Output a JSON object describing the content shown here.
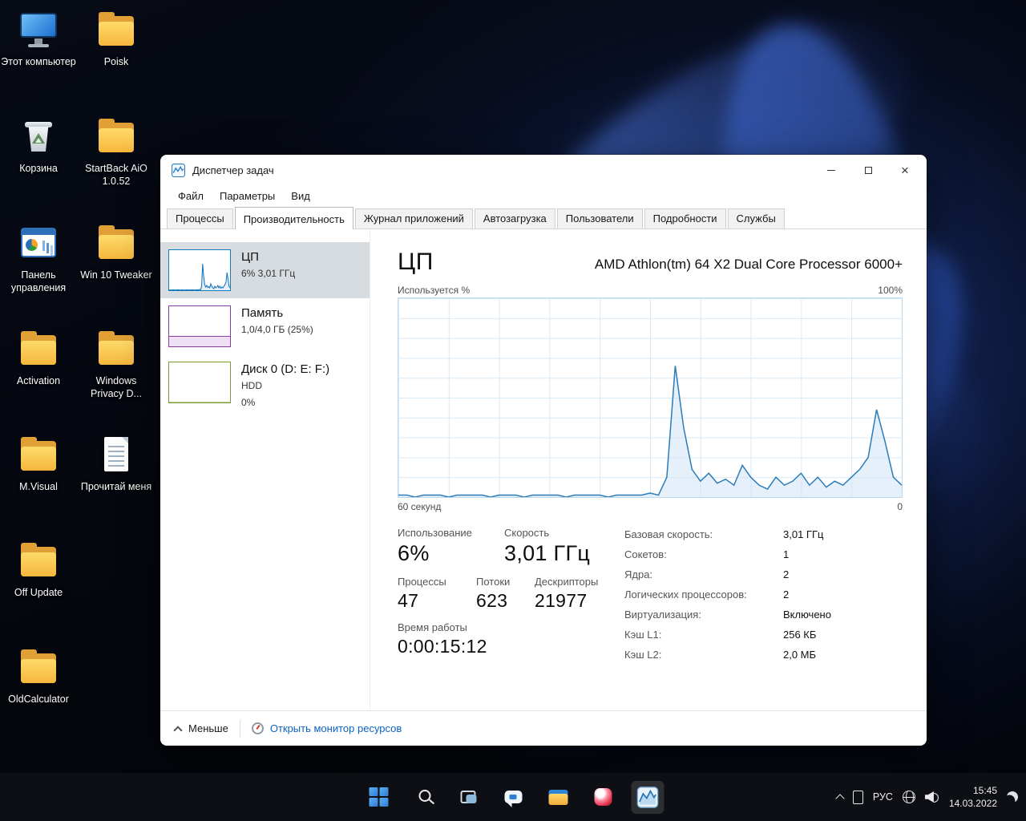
{
  "theme": {
    "accent_blue": "#0078d4",
    "cpu_color": "#117dbb",
    "memory_color": "#8b3ba6",
    "disk_color": "#7d9b38",
    "link_color": "#0a62c4",
    "folder_yellow": "#f6b73c",
    "taskbar_bg": "#0d1015",
    "selected_sidebar_bg": "#d6dce0"
  },
  "desktop": {
    "icons": [
      {
        "label": "Этот компьютер",
        "type": "computer"
      },
      {
        "label": "Poisk",
        "type": "folder"
      },
      {
        "label": "Корзина",
        "type": "recycle-bin"
      },
      {
        "label": "StartBack AiO 1.0.52",
        "type": "folder"
      },
      {
        "label": "Панель управления",
        "type": "control-panel"
      },
      {
        "label": "Win 10 Tweaker",
        "type": "folder"
      },
      {
        "label": "Activation",
        "type": "folder"
      },
      {
        "label": "Windows Privacy D...",
        "type": "folder"
      },
      {
        "label": "M.Visual",
        "type": "folder"
      },
      {
        "label": "Прочитай меня",
        "type": "document"
      },
      {
        "label": "Off Update",
        "type": "folder"
      },
      {
        "label": "OldCalculator",
        "type": "folder"
      }
    ]
  },
  "window": {
    "title": "Диспетчер задач",
    "menu": [
      "Файл",
      "Параметры",
      "Вид"
    ],
    "tabs": [
      "Процессы",
      "Производительность",
      "Журнал приложений",
      "Автозагрузка",
      "Пользователи",
      "Подробности",
      "Службы"
    ],
    "active_tab": "Производительность",
    "sidebar": [
      {
        "title": "ЦП",
        "line1": "6% 3,01 ГГц"
      },
      {
        "title": "Память",
        "line1": "1,0/4,0 ГБ (25%)"
      },
      {
        "title": "Диск 0 (D: E: F:)",
        "line1": "HDD",
        "line2": "0%"
      }
    ],
    "main": {
      "section_title": "ЦП",
      "processor_name": "AMD Athlon(tm) 64 X2 Dual Core Processor 6000+",
      "graph_label_left": "Используется %",
      "graph_label_right": "100%",
      "graph_bottom_left": "60 секунд",
      "graph_bottom_right": "0",
      "stats": [
        {
          "label": "Использование",
          "value": "6%"
        },
        {
          "label": "Скорость",
          "value": "3,01 ГГц"
        },
        {
          "label": "Процессы",
          "value": "47"
        },
        {
          "label": "Потоки",
          "value": "623"
        },
        {
          "label": "Дескрипторы",
          "value": "21977"
        },
        {
          "label": "Время работы",
          "value": "0:00:15:12"
        }
      ],
      "details": [
        {
          "label": "Базовая скорость:",
          "value": "3,01 ГГц"
        },
        {
          "label": "Сокетов:",
          "value": "1"
        },
        {
          "label": "Ядра:",
          "value": "2"
        },
        {
          "label": "Логических процессоров:",
          "value": "2"
        },
        {
          "label": "Виртуализация:",
          "value": "Включено"
        },
        {
          "label": "Кэш L1:",
          "value": "256 КБ"
        },
        {
          "label": "Кэш L2:",
          "value": "2,0 МБ"
        }
      ]
    },
    "footer": {
      "less_label": "Меньше",
      "resource_monitor_label": "Открыть монитор ресурсов"
    }
  },
  "taskbar": {
    "buttons": [
      "start",
      "search",
      "task-view",
      "chat",
      "file-explorer",
      "media-app",
      "task-manager"
    ],
    "active_button": "task-manager",
    "tray": {
      "language": "РУС",
      "time": "15:45",
      "date": "14.03.2022"
    }
  },
  "chart_data": [
    {
      "type": "area",
      "title": "ЦП — Используется %",
      "xlabel": "60 секунд (слева) → 0 (справа)",
      "ylabel": "Загрузка ЦП, %",
      "ylim": [
        0,
        100
      ],
      "x_range_seconds": [
        60,
        0
      ],
      "grid": true,
      "legend_position": "none",
      "series_color": "#117dbb",
      "values": [
        1,
        1,
        0,
        1,
        1,
        1,
        0,
        1,
        1,
        1,
        1,
        0,
        1,
        1,
        1,
        0,
        1,
        1,
        1,
        1,
        0,
        1,
        1,
        1,
        1,
        0,
        1,
        1,
        1,
        1,
        2,
        1,
        10,
        66,
        35,
        14,
        8,
        12,
        7,
        9,
        6,
        16,
        10,
        6,
        4,
        10,
        6,
        8,
        12,
        6,
        10,
        5,
        8,
        6,
        10,
        14,
        20,
        44,
        28,
        10,
        6
      ]
    },
    {
      "type": "area",
      "title": "Память — мини-график (1,0/4,0 ГБ)",
      "ylim": [
        0,
        100
      ],
      "series_color": "#8b3ba6",
      "values_constant": 25
    },
    {
      "type": "area",
      "title": "Диск 0 — мини-график (0%)",
      "ylim": [
        0,
        100
      ],
      "series_color": "#7d9b38",
      "values_constant": 0
    }
  ]
}
